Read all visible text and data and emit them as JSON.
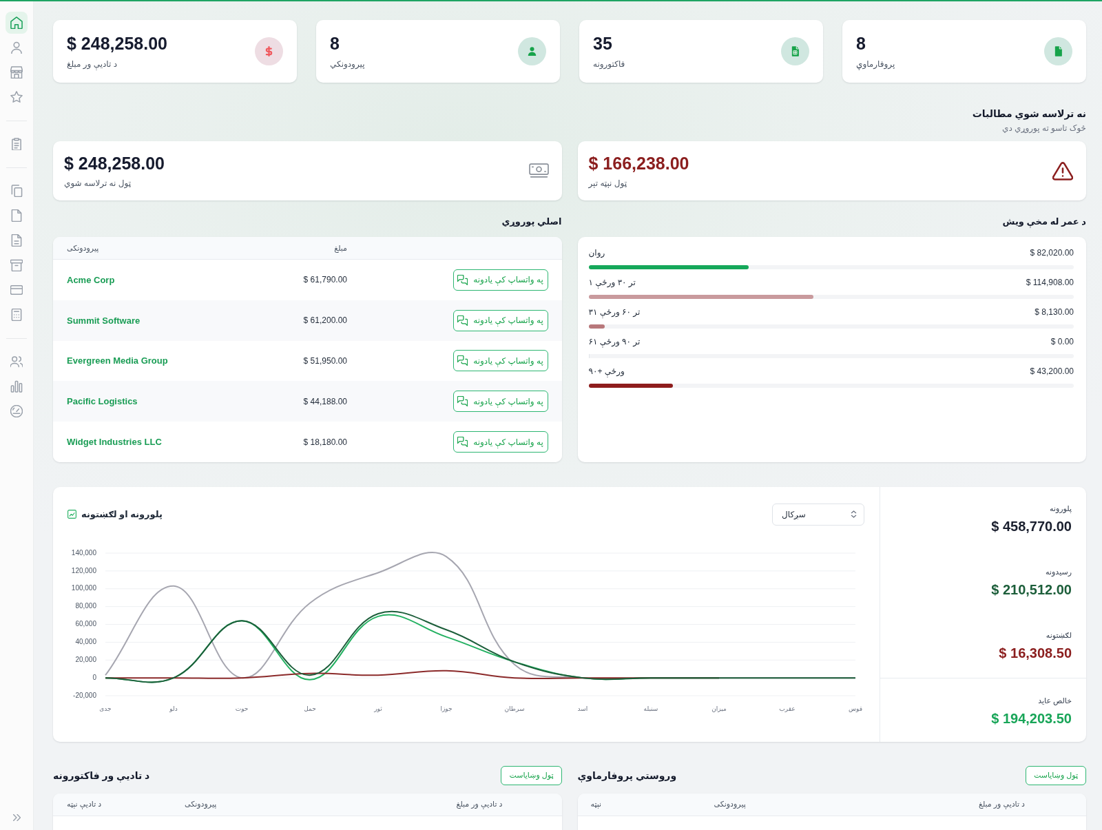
{
  "sidebar": {
    "groups": [
      {
        "items": [
          {
            "selected": true
          },
          {
            "selected": false
          },
          {
            "selected": false
          },
          {
            "selected": false
          }
        ]
      },
      {
        "items": [
          {
            "selected": false
          }
        ]
      },
      {
        "items": [
          {
            "selected": false
          },
          {
            "selected": false
          },
          {
            "selected": false
          },
          {
            "selected": false
          },
          {
            "selected": false
          },
          {
            "selected": false
          }
        ]
      },
      {
        "items": [
          {
            "selected": false
          },
          {
            "selected": false
          },
          {
            "selected": false
          }
        ]
      }
    ]
  },
  "stat_cards": [
    {
      "value": "8",
      "label": "پروفارماوې",
      "color": "#16a34a"
    },
    {
      "value": "35",
      "label": "فاکتورونه",
      "color": "#16a34a"
    },
    {
      "value": "8",
      "label": "پیرودونکي",
      "color": "#16a34a"
    },
    {
      "value": "$ 248,258.00",
      "label": "د تادیې ور مبلغ",
      "color": "#f05a5f"
    }
  ],
  "receivables": {
    "title": "نه ترلاسه شوي مطالبات",
    "subtitle": "څوک تاسو ته پوروړي دي",
    "cards": [
      {
        "kind": "overdue",
        "value": "$ 166,238.00",
        "label": "ټول نېټه تېر"
      },
      {
        "kind": "total",
        "value": "$ 248,258.00",
        "label": "ټول نه ترلاسه شوي"
      }
    ]
  },
  "top_debtors": {
    "title": "اصلي پوروړي",
    "columns": [
      "مبلغ",
      "پیرودونکی"
    ],
    "rows": [
      {
        "customer": "Acme Corp",
        "amount": "$ 61,790.00",
        "action": "په واتساپ کې یادونه"
      },
      {
        "customer": "Summit Software",
        "amount": "$ 61,200.00",
        "action": "په واتساپ کې یادونه"
      },
      {
        "customer": "Evergreen Media Group",
        "amount": "$ 51,950.00",
        "action": "په واتساپ کې یادونه"
      },
      {
        "customer": "Pacific Logistics",
        "amount": "$ 44,188.00",
        "action": "په واتساپ کې یادونه"
      },
      {
        "customer": "Widget Industries LLC",
        "amount": "$ 18,180.00",
        "action": "په واتساپ کې یادونه"
      }
    ]
  },
  "aging": {
    "title": "د عمر له مخې ویش",
    "buckets": [
      {
        "label": "روان",
        "amount": "$ 82,020.00",
        "level": 0.33,
        "color": "#16a85a"
      },
      {
        "label": "۱ تر ۳۰ ورځې",
        "amount": "$ 114,908.00",
        "level": 0.463,
        "color": "#c99a9d"
      },
      {
        "label": "۳۱ تر ۶۰ ورځې",
        "amount": "$ 8,130.00",
        "level": 0.033,
        "color": "#b8787b"
      },
      {
        "label": "۶۱ تر ۹۰ ورځې",
        "amount": "$ 0.00",
        "level": 0
      },
      {
        "label": "۹۰+ ورځې",
        "amount": "$ 43,200.00",
        "level": 0.174,
        "color": "#8e1d1d"
      }
    ]
  },
  "chart_panel": {
    "period_select": {
      "value": "سږکال"
    },
    "chart_data": {
      "type": "line",
      "title": "پلورونه او لګښتونه",
      "grid": true,
      "categories": [
        "جدی",
        "دلو",
        "حوت",
        "حمل",
        "ثور",
        "جوزا",
        "سرطان",
        "اسد",
        "سنبله",
        "میزان",
        "عقرب",
        "قوس"
      ],
      "series": [
        {
          "color": "#a6a6b0",
          "values": [
            3000,
            103000,
            0,
            84000,
            118000,
            136000,
            15000,
            0,
            0,
            0,
            0,
            0
          ]
        },
        {
          "color": "#22b060",
          "values": [
            0,
            0,
            64000,
            -2000,
            69000,
            46000,
            18000,
            0,
            0,
            0,
            null,
            null
          ]
        },
        {
          "color": "#8b2a2a",
          "values": [
            0,
            0,
            0,
            5000,
            3000,
            8000,
            0,
            0,
            0,
            0,
            null,
            null
          ]
        },
        {
          "color": "#1c5e3a",
          "values": [
            0,
            0,
            64000,
            3000,
            72000,
            54000,
            18000,
            0,
            0,
            0,
            0,
            0
          ]
        }
      ],
      "ylim": [
        -20000,
        140000
      ],
      "yticks": [
        {
          "value": -20000,
          "label": "-20,000"
        },
        {
          "value": 0,
          "label": "0"
        },
        {
          "value": 20000,
          "label": "20,000"
        },
        {
          "value": 40000,
          "label": "40,000"
        },
        {
          "value": 60000,
          "label": "60,000"
        },
        {
          "value": 80000,
          "label": "80,000"
        },
        {
          "value": 100000,
          "label": "100,000"
        },
        {
          "value": 120000,
          "label": "120,000"
        },
        {
          "value": 140000,
          "label": "140,000"
        }
      ]
    },
    "totals": [
      {
        "label": "پلورونه",
        "value": "$ 458,770.00",
        "color": "#1a1f2e"
      },
      {
        "label": "رسیدونه",
        "value": "$ 210,512.00",
        "color": "#1c5e3a"
      },
      {
        "label": "لګښتونه",
        "value": "$ 16,308.50",
        "color": "#8b1e1e"
      }
    ],
    "net": {
      "label": "خالص عاید",
      "value": "$ 194,203.50",
      "color": "#18a558"
    }
  },
  "unpaid_invoices": {
    "title": "د تادیې ور فاکتورونه",
    "button": "ټول وښایاست",
    "columns": [
      "د تادیې ور مبلغ",
      "پیرودونکی",
      "د تادیې نېټه"
    ]
  },
  "recent_proformas": {
    "title": "وروستي پروفارماوې",
    "button": "ټول وښایاست",
    "columns": [
      "د تادیې ور مبلغ",
      "پیرودونکی",
      "نېټه"
    ]
  }
}
